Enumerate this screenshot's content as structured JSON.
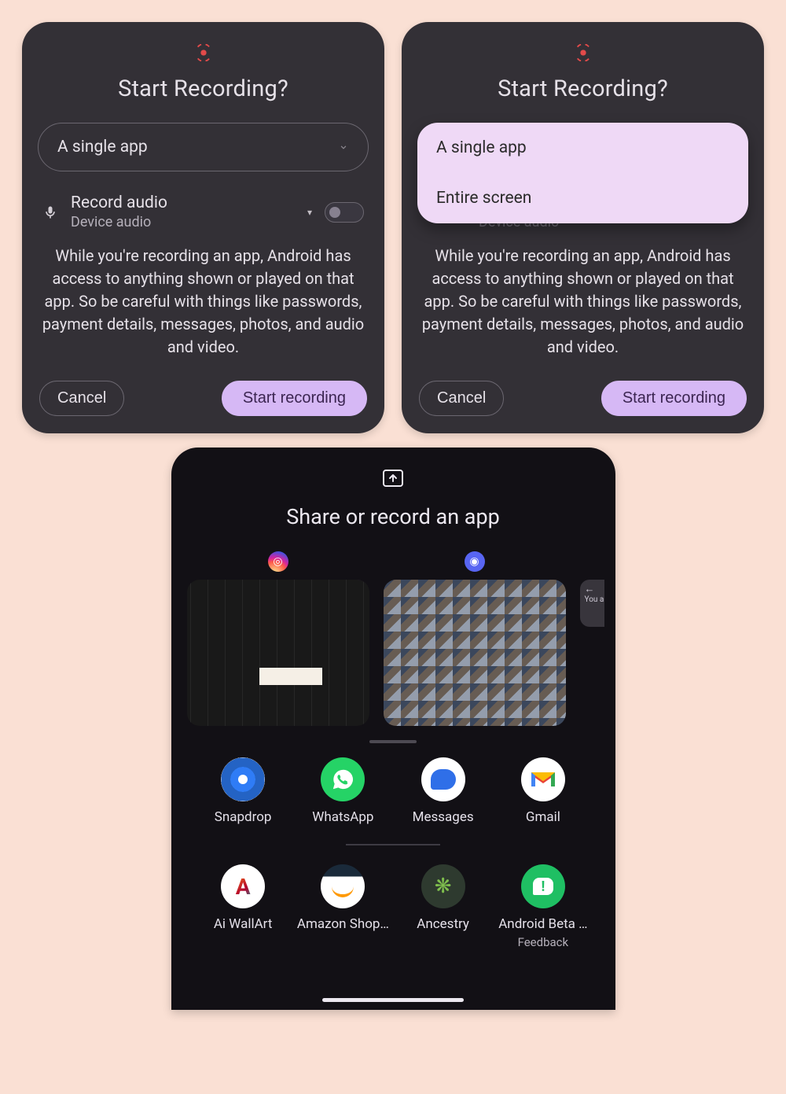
{
  "recording": {
    "title": "Start Recording?",
    "mode_selected": "A single app",
    "mode_options": [
      "A single app",
      "Entire screen"
    ],
    "audio_label": "Record audio",
    "audio_sub": "Device audio",
    "audio_enabled": false,
    "warning": "While you're recording an app, Android has access to anything shown or played on that app. So be careful with things like passwords, payment details, messages, photos, and audio and video.",
    "cancel": "Cancel",
    "start": "Start recording"
  },
  "share_sheet": {
    "title": "Share or record an app",
    "recent_apps": [
      {
        "name": "Instagram",
        "icon": "instagram-icon"
      },
      {
        "name": "Discord",
        "icon": "discord-icon"
      },
      {
        "name": "partial",
        "icon": ""
      }
    ],
    "partial_hint_top": "←",
    "partial_hint_text": "You and",
    "apps_row1": [
      {
        "label": "Snapdrop",
        "icon": "snapdrop-icon"
      },
      {
        "label": "WhatsApp",
        "icon": "whatsapp-icon"
      },
      {
        "label": "Messages",
        "icon": "messages-icon"
      },
      {
        "label": "Gmail",
        "icon": "gmail-icon"
      }
    ],
    "apps_row2": [
      {
        "label": "Ai WallArt",
        "sub": "",
        "icon": "ai-wallart-icon"
      },
      {
        "label": "Amazon Shop…",
        "sub": "",
        "icon": "amazon-icon"
      },
      {
        "label": "Ancestry",
        "sub": "",
        "icon": "ancestry-icon"
      },
      {
        "label": "Android Beta …",
        "sub": "Feedback",
        "icon": "android-beta-icon"
      }
    ]
  }
}
